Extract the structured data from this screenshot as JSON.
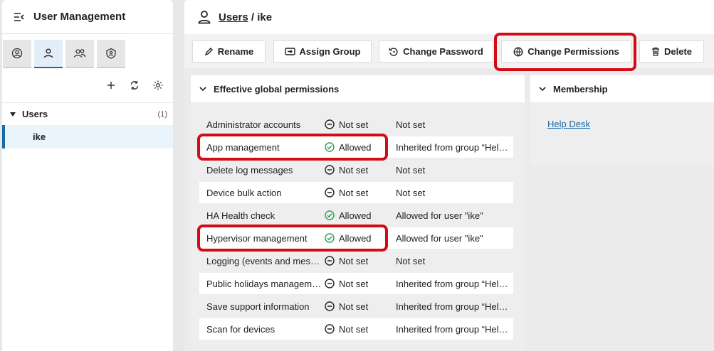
{
  "left": {
    "title": "User Management",
    "tabs": [
      "user-circle-icon",
      "user-icon",
      "users-icon",
      "shield-user-icon"
    ],
    "tree": {
      "label": "Users",
      "count": "(1)",
      "child": "ike"
    }
  },
  "header": {
    "section": "Users",
    "separator": " / ",
    "user": "ike"
  },
  "toolbar": {
    "rename": "Rename",
    "assign_group": "Assign Group",
    "change_password": "Change Password",
    "change_permissions": "Change Permissions",
    "delete": "Delete"
  },
  "permissions": {
    "title": "Effective global permissions",
    "rows": [
      {
        "name": "Administrator accounts",
        "status": "Not set",
        "allowed": false,
        "source": "Not set"
      },
      {
        "name": "App management",
        "status": "Allowed",
        "allowed": true,
        "source": "Inherited from group “Hel…"
      },
      {
        "name": "Delete log messages",
        "status": "Not set",
        "allowed": false,
        "source": "Not set"
      },
      {
        "name": "Device bulk action",
        "status": "Not set",
        "allowed": false,
        "source": "Not set"
      },
      {
        "name": "HA Health check",
        "status": "Allowed",
        "allowed": true,
        "source": "Allowed for user \"ike\""
      },
      {
        "name": "Hypervisor management",
        "status": "Allowed",
        "allowed": true,
        "source": "Allowed for user \"ike\""
      },
      {
        "name": "Logging (events and mes…",
        "status": "Not set",
        "allowed": false,
        "source": "Not set"
      },
      {
        "name": "Public holidays managem…",
        "status": "Not set",
        "allowed": false,
        "source": "Inherited from group “Hel…"
      },
      {
        "name": "Save support information",
        "status": "Not set",
        "allowed": false,
        "source": "Inherited from group “Hel…"
      },
      {
        "name": "Scan for devices",
        "status": "Not set",
        "allowed": false,
        "source": "Inherited from group “Hel…"
      }
    ]
  },
  "membership": {
    "title": "Membership",
    "groups": [
      "Help Desk"
    ]
  },
  "colors": {
    "accent": "#1a6aa6",
    "highlight": "#d30b16",
    "allowed": "#2e9e4f"
  }
}
